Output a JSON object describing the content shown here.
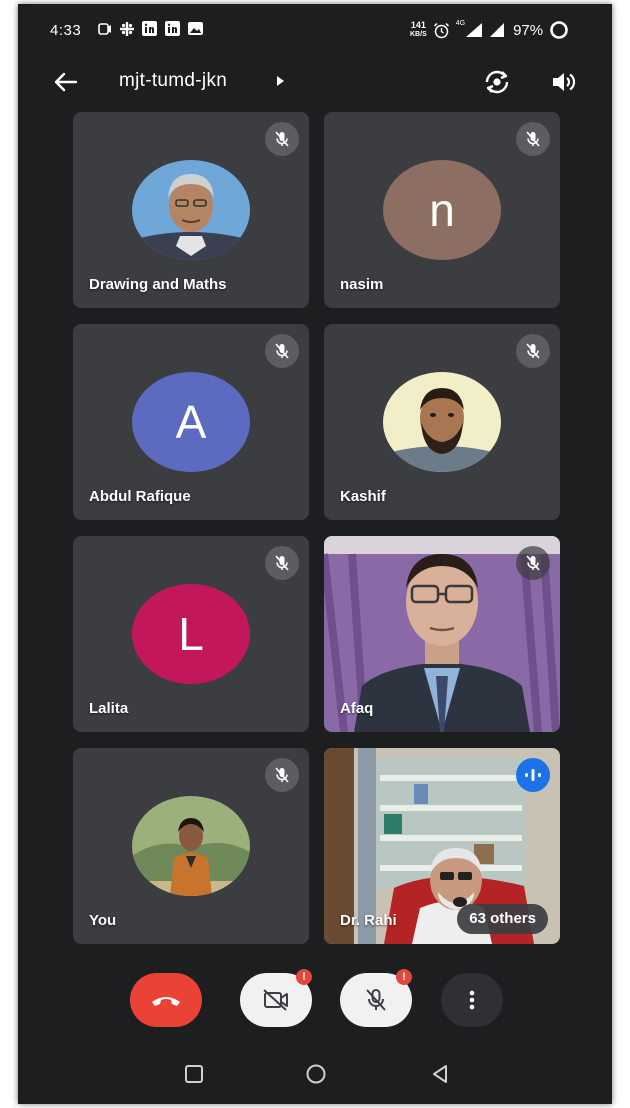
{
  "status_bar": {
    "time": "4:33",
    "net_speed_value": "141",
    "net_speed_unit": "KB/S",
    "network_label": "4G",
    "battery": "97%",
    "left_icons": [
      "screen-record-icon",
      "grid-app-icon",
      "linkedin-icon",
      "linkedin-icon",
      "gallery-icon"
    ],
    "right_icons": [
      "alarm-icon",
      "signal-icon",
      "signal-icon",
      "battery-icon"
    ]
  },
  "top_bar": {
    "meeting_code": "mjt-tumd-jkn",
    "icons": [
      "back-arrow-icon",
      "caret-right-icon",
      "switch-camera-icon",
      "speaker-icon"
    ]
  },
  "participants": [
    {
      "name": "Drawing and Maths",
      "avatar": "photo",
      "muted": true
    },
    {
      "name": "nasim",
      "avatar": "letter",
      "letter": "n",
      "color": "#8d6e63",
      "muted": true
    },
    {
      "name": "Abdul Rafique",
      "avatar": "letter",
      "letter": "A",
      "color": "#5c6bc0",
      "muted": true
    },
    {
      "name": "Kashif",
      "avatar": "photo",
      "muted": true
    },
    {
      "name": "Lalita",
      "avatar": "letter",
      "letter": "L",
      "color": "#c2185b",
      "muted": true
    },
    {
      "name": "Afaq",
      "avatar": "video",
      "muted": true
    },
    {
      "name": "You",
      "avatar": "photo",
      "muted": true
    },
    {
      "name": "Dr. Rahi",
      "avatar": "video",
      "speaking": true
    }
  ],
  "others_label": "63 others",
  "controls": {
    "end_call_color": "#ea4335",
    "icons": [
      "end-call-icon",
      "camera-off-icon",
      "mic-off-icon",
      "more-options-icon"
    ]
  },
  "nav": {
    "icons": [
      "recents-square-icon",
      "home-circle-icon",
      "back-triangle-icon"
    ]
  },
  "colors": {
    "background": "#1d1e20",
    "tile": "#3c3d40",
    "accent_blue": "#1a73e8",
    "warning": "#e2473b"
  }
}
